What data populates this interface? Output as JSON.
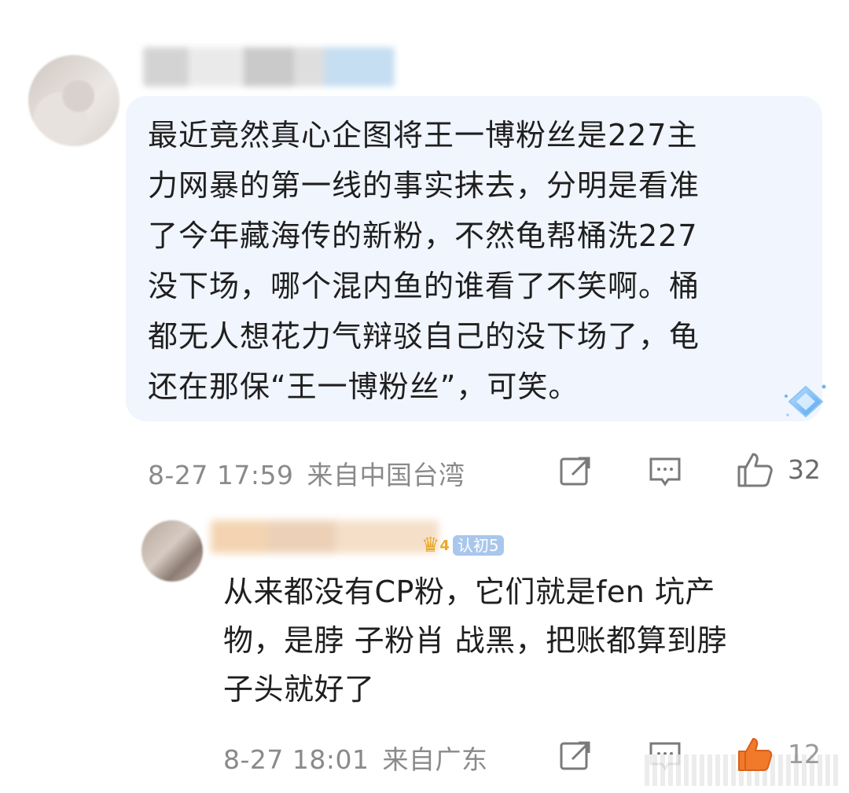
{
  "comments": [
    {
      "text": "最近竟然真心企图将王一博粉丝是227主\n力网暴的第一线的事实抹去，分明是看准\n了今年藏海传的新粉，不然龟帮桶洗227\n没下场，哪个混内鱼的谁看了不笑啊。桶\n都无人想花力气辩驳自己的没下场了，龟\n还在那保“王一博粉丝”，可笑。",
      "timestamp": "8-27 17:59",
      "location": "来自中国台湾",
      "likes": "32"
    },
    {
      "text": "从来都没有CP粉，它们就是fen 坑产\n物，是脖 子粉肖 战黑，把账都算到脖\n子头就好了",
      "timestamp": "8-27 18:01",
      "location": "来自广东",
      "likes": "12",
      "badge_level": "4",
      "fans_badge": "认初5"
    }
  ],
  "icons": [
    "share-icon",
    "comment-icon",
    "like-icon",
    "diamond-badge-icon",
    "crown-icon"
  ],
  "colors": {
    "bubble": "#f1f5fd",
    "meta": "#8a8a8a",
    "like_active": "#f07a2a"
  }
}
